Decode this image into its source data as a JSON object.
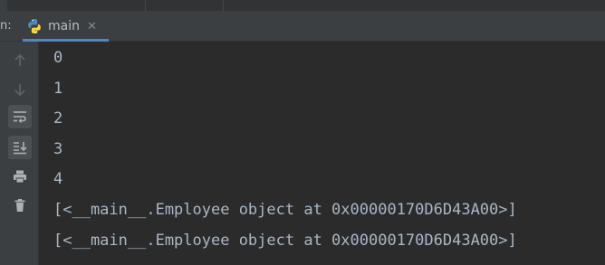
{
  "run_panel": {
    "prefix": "n:",
    "tab": {
      "label": "main",
      "icon": "python-icon",
      "close": "✕"
    }
  },
  "toolbar": {
    "buttons": [
      {
        "name": "up-arrow-icon",
        "tooltip": ""
      },
      {
        "name": "down-arrow-icon",
        "tooltip": ""
      },
      {
        "name": "soft-wrap-icon",
        "tooltip": ""
      },
      {
        "name": "scroll-to-end-icon",
        "tooltip": ""
      },
      {
        "name": "print-icon",
        "tooltip": ""
      },
      {
        "name": "trash-icon",
        "tooltip": ""
      }
    ]
  },
  "console": {
    "lines": [
      "0",
      "1",
      "2",
      "3",
      "4",
      "[<__main__.Employee object at 0x00000170D6D43A00>]",
      "[<__main__.Employee object at 0x00000170D6D43A00>]"
    ],
    "text_color": "#a9b7c6"
  },
  "colors": {
    "background": "#2b2b2b",
    "panel": "#3c3f41",
    "accent": "#4a88c7"
  }
}
